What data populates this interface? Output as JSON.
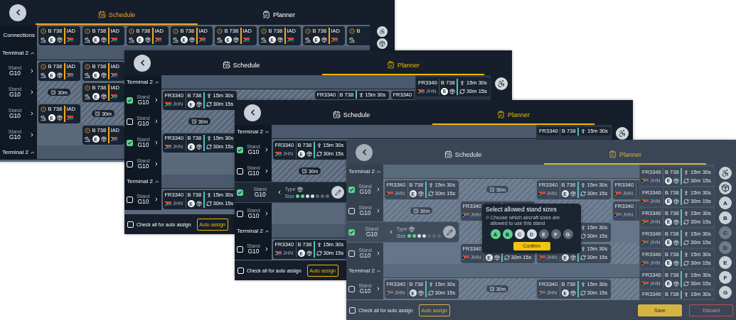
{
  "windows": [
    {
      "kind": "schedule",
      "dimmed": false,
      "tabs": [
        {
          "label": "Schedule",
          "selected": true
        },
        {
          "label": "Planner",
          "selected": false
        }
      ],
      "connections": {
        "label": "Connections",
        "flights": [
          {
            "model": "B 738",
            "category": "E",
            "dest": "IAD"
          },
          {
            "model": "B 738",
            "category": "E",
            "dest": "IAD"
          },
          {
            "model": "B 738",
            "category": "E",
            "dest": "IAD"
          },
          {
            "model": "B 738",
            "category": "E",
            "dest": "IAD"
          },
          {
            "model": "B 738",
            "category": "E",
            "dest": "IAD"
          },
          {
            "model": "B 738",
            "category": "E",
            "dest": "IAD"
          },
          {
            "model": "B 738",
            "category": "E",
            "dest": "IAD"
          },
          {
            "model": "B"
          }
        ]
      },
      "tools": [
        {
          "kind": "wheelchair"
        },
        {
          "kind": "cargo"
        }
      ],
      "groups": [
        {
          "title": "Terminal 2",
          "expanded": true,
          "stands": [
            {
              "label": "Stand",
              "name": "G10",
              "expanded": false,
              "slots": [
                {
                  "kind": "flight",
                  "model": "B 738",
                  "category": "E",
                  "dest": "IAD"
                },
                {
                  "kind": "flight",
                  "model": "B 738",
                  "category": "E",
                  "dest": "IAD"
                }
              ]
            },
            {
              "label": "Stand",
              "name": "G10",
              "expanded": false,
              "slots": [
                {
                  "kind": "break",
                  "duration": "30m"
                },
                {
                  "kind": "flight",
                  "model": "B 738",
                  "category": "E",
                  "dest": "IAD"
                }
              ]
            },
            {
              "label": "Stand",
              "name": "G10",
              "expanded": false,
              "slots": [
                {
                  "kind": "flight",
                  "model": "B 738",
                  "category": "E",
                  "dest": "IAD"
                },
                {
                  "kind": "break",
                  "duration": "30m"
                }
              ]
            },
            {
              "label": "Stand",
              "name": "G10",
              "expanded": false,
              "slots": [
                {
                  "kind": "empty"
                },
                {
                  "kind": "flight",
                  "model": "B 738",
                  "category": "E",
                  "dest": "IAD"
                }
              ]
            }
          ]
        },
        {
          "title": "Terminal 2",
          "expanded": true
        }
      ]
    },
    {
      "kind": "planner",
      "dimmed": false,
      "tabs": [
        {
          "label": "Schedule",
          "selected": false
        },
        {
          "label": "Planner",
          "selected": true
        }
      ],
      "queue": [
        {
          "flight": "FR3340",
          "origin": "JHN",
          "model": "B 738",
          "category": "E",
          "transfer": "15m 30s",
          "turnaround": "30m 15s"
        }
      ],
      "tools": [
        {
          "kind": "wheelchair"
        }
      ],
      "groups": [
        {
          "title": "Terminal 2",
          "expanded": true,
          "stands": [
            {
              "label": "Stand",
              "name": "G10",
              "checked": true,
              "expanded": false,
              "slots": [
                {
                  "kind": "flight",
                  "flight": "FR3340",
                  "origin": "JHN",
                  "model": "B 738",
                  "category": "E",
                  "transfer": "15m 30s",
                  "turnaround": "30m 15s"
                },
                {
                  "kind": "break"
                },
                {
                  "kind": "flight",
                  "flight": "FR3340",
                  "model": "B 738",
                  "transfer": "15m 30s"
                },
                {
                  "kind": "flight",
                  "flight": "FR3340"
                }
              ]
            },
            {
              "label": "Stand",
              "name": "G10",
              "checked": false,
              "expanded": false,
              "slots": [
                {
                  "kind": "break",
                  "duration": "30m"
                }
              ]
            },
            {
              "label": "Stand",
              "name": "G10",
              "checked": true,
              "expanded": false,
              "slots": [
                {
                  "kind": "flight",
                  "flight": "FR3340",
                  "origin": "JHN",
                  "model": "B 738",
                  "category": "E",
                  "transfer": "15m 30s",
                  "turnaround": "30m 15s"
                }
              ]
            },
            {
              "label": "Stand",
              "name": "G10",
              "checked": false,
              "expanded": false
            }
          ]
        },
        {
          "title": "Terminal 2",
          "expanded": true,
          "stands": [
            {
              "label": "Stand",
              "name": "G10",
              "checked": false,
              "expanded": false,
              "slots": [
                {
                  "kind": "flight",
                  "flight": "FR3340",
                  "origin": "JHN",
                  "model": "B 738",
                  "category": "E",
                  "transfer": "15m 30s",
                  "turnaround": "30m 15s"
                }
              ]
            }
          ]
        }
      ],
      "footer": {
        "check_all": {
          "label": "Check all for auto assign",
          "checked": false
        },
        "buttons": [
          {
            "label": "Auto assign",
            "kind": "outline"
          }
        ]
      }
    },
    {
      "kind": "planner",
      "dimmed": false,
      "tabs": [
        {
          "label": "Schedule",
          "selected": false
        },
        {
          "label": "Planner",
          "selected": true
        }
      ],
      "queue": [
        {
          "flight": "FR3340",
          "model": "B 738",
          "transfer": "15m 30s"
        }
      ],
      "tools": [
        {
          "kind": "wheelchair"
        }
      ],
      "groups": [
        {
          "title": "Terminal 2",
          "expanded": true,
          "stands": [
            {
              "label": "Stand",
              "name": "G10",
              "checked": true,
              "expanded": false,
              "slots": [
                {
                  "kind": "flight",
                  "flight": "FR3340",
                  "origin": "JHN",
                  "model": "B 738",
                  "category": "E",
                  "transfer": "15m 30s",
                  "turnaround": "30m 15s"
                }
              ]
            },
            {
              "label": "Stand",
              "name": "G10",
              "checked": false,
              "expanded": false,
              "slots": [
                {
                  "kind": "break",
                  "duration": "30m"
                }
              ]
            },
            {
              "label": "Stand",
              "name": "G10",
              "checked": true,
              "expanded": true,
              "type_label": "Type",
              "size_label": "Size",
              "sizes": [
                {
                  "selected": true,
                  "disabled": false
                },
                {
                  "selected": true,
                  "disabled": false
                },
                {
                  "selected": false,
                  "disabled": false
                },
                {
                  "selected": false,
                  "disabled": false
                },
                {
                  "selected": false,
                  "disabled": true
                },
                {
                  "selected": false,
                  "disabled": true
                },
                {
                  "selected": false,
                  "disabled": true
                }
              ]
            },
            {
              "label": "Stand",
              "name": "G10",
              "checked": false,
              "expanded": false
            }
          ]
        },
        {
          "title": "Terminal 2",
          "expanded": true,
          "stands": [
            {
              "label": "Stand",
              "name": "G10",
              "checked": false,
              "expanded": false,
              "slots": [
                {
                  "kind": "flight",
                  "flight": "FR3340",
                  "origin": "JHN",
                  "model": "B 738",
                  "category": "E",
                  "transfer": "15m 30s",
                  "turnaround": "30m 15s"
                }
              ]
            }
          ]
        }
      ],
      "footer": {
        "check_all": {
          "label": "Check all for auto assign",
          "checked": false
        },
        "buttons": [
          {
            "label": "Auto assign",
            "kind": "outline"
          }
        ]
      }
    },
    {
      "kind": "planner",
      "dimmed": true,
      "tabs": [
        {
          "label": "Schedule",
          "selected": false
        },
        {
          "label": "Planner",
          "selected": true
        }
      ],
      "queue": [
        {
          "flight": "FR3340",
          "origin": "JHN",
          "model": "B 738",
          "category": "E",
          "transfer": "15m 30s",
          "turnaround": "30m 15s"
        },
        {
          "flight": "FR3340",
          "origin": "JHN",
          "model": "B 738",
          "category": "E",
          "transfer": "15m 30s",
          "turnaround": "30m 15s"
        },
        {
          "flight": "FR3340",
          "origin": "JHN",
          "model": "B 738",
          "category": "E",
          "transfer": "15m 30s",
          "turnaround": "30m 15s"
        },
        {
          "flight": "FR3340",
          "origin": "JHN",
          "model": "B 738",
          "category": "E",
          "transfer": "15m 30s",
          "turnaround": "30m 15s"
        },
        {
          "flight": "FR3340",
          "origin": "JHN",
          "model": "B 738",
          "category": "E",
          "transfer": "15m 30s",
          "turnaround": "30m 15s"
        },
        {
          "flight": "FR3340",
          "origin": "JHN",
          "model": "B 738",
          "category": "E",
          "transfer": "15m 30s",
          "turnaround": "30m 15s"
        },
        {
          "flight": "FR3340",
          "model": "B 738",
          "transfer": "15m 30s"
        }
      ],
      "tools": [
        {
          "kind": "wheelchair"
        },
        {
          "kind": "cargo"
        },
        {
          "kind": "size",
          "label": "A",
          "disabled": false
        },
        {
          "kind": "size",
          "label": "B",
          "disabled": false
        },
        {
          "kind": "size",
          "label": "C",
          "disabled": true
        },
        {
          "kind": "size",
          "label": "D",
          "disabled": true
        },
        {
          "kind": "size",
          "label": "E",
          "disabled": false
        },
        {
          "kind": "size",
          "label": "F",
          "disabled": false
        },
        {
          "kind": "size",
          "label": "G",
          "disabled": false
        }
      ],
      "groups": [
        {
          "title": "Terminal 2",
          "expanded": true,
          "stands": [
            {
              "label": "Stand",
              "name": "G10",
              "checked": true,
              "expanded": false,
              "slots": [
                {
                  "kind": "flight",
                  "flight": "FR3340",
                  "origin": "JHN",
                  "model": "B 738",
                  "category": "E",
                  "transfer": "15m 30s",
                  "turnaround": "30m 15s"
                },
                {
                  "kind": "break",
                  "duration": "30m"
                },
                {
                  "kind": "flight",
                  "flight": "FR3340",
                  "origin": "JHN",
                  "model": "B 738",
                  "category": "E",
                  "transfer": "15m 30s",
                  "turnaround": "30m 15s"
                },
                {
                  "kind": "flight",
                  "flight": "FR3340",
                  "origin": "JHN"
                }
              ]
            },
            {
              "label": "Stand",
              "name": "G10",
              "checked": false,
              "expanded": false,
              "slots": [
                {
                  "kind": "break",
                  "duration": "30m"
                },
                {
                  "kind": "flight",
                  "flight": "FR3340",
                  "origin": "JHN"
                },
                {
                  "kind": "break"
                },
                {
                  "kind": "flight",
                  "flight": "FR3340",
                  "origin": "JHN"
                }
              ]
            },
            {
              "label": "Stand",
              "name": "G10",
              "checked": true,
              "expanded": true,
              "type_label": "Type",
              "size_label": "Size",
              "sizes": [
                {
                  "selected": true,
                  "disabled": false
                },
                {
                  "selected": true,
                  "disabled": false
                },
                {
                  "selected": false,
                  "disabled": false
                },
                {
                  "selected": false,
                  "disabled": false
                },
                {
                  "selected": false,
                  "disabled": true
                },
                {
                  "selected": false,
                  "disabled": true
                },
                {
                  "selected": false,
                  "disabled": true
                }
              ],
              "slots": [
                {
                  "kind": "break"
                },
                {
                  "kind": "flight",
                  "transfer": "15m 30s",
                  "turnaround": "30m 15s"
                }
              ]
            },
            {
              "label": "Stand",
              "name": "G10",
              "checked": false,
              "expanded": false,
              "slots": [
                {
                  "kind": "empty"
                },
                {
                  "kind": "flight",
                  "flight": "FR3340",
                  "origin": "JHN",
                  "category": "E",
                  "turnaround": "30m 15s"
                },
                {
                  "kind": "flight",
                  "origin": "JHN",
                  "category": "E",
                  "transfer": "15m 30s",
                  "turnaround": "30m 15s"
                },
                {
                  "kind": "break"
                }
              ]
            }
          ]
        },
        {
          "title": "Terminal 2",
          "expanded": true,
          "stands": [
            {
              "label": "Stand",
              "name": "G10",
              "checked": false,
              "expanded": false,
              "slots": [
                {
                  "kind": "flight",
                  "flight": "FR3340",
                  "origin": "JHN",
                  "model": "B 738",
                  "category": "E",
                  "transfer": "15m 30s",
                  "turnaround": "30m 15s"
                },
                {
                  "kind": "break",
                  "duration": "30m"
                },
                {
                  "kind": "flight",
                  "flight": "FR3340",
                  "origin": "JHN",
                  "model": "B 738",
                  "category": "E",
                  "transfer": "15m 30s",
                  "turnaround": "30m 15s"
                },
                {
                  "kind": "break"
                }
              ]
            }
          ]
        }
      ],
      "footer": {
        "check_all": {
          "label": "Check all for auto assign",
          "checked": false
        },
        "buttons": [
          {
            "label": "Auto assign",
            "kind": "outline"
          },
          {
            "label": "Save",
            "kind": "primary"
          },
          {
            "label": "Discard",
            "kind": "danger"
          }
        ]
      },
      "popup": {
        "title": "Select allowed stand sizes",
        "hint": "Choose which aircraft sizes are allowed to use this stand",
        "sizes": [
          {
            "label": "A",
            "selected": true,
            "disabled": false
          },
          {
            "label": "B",
            "selected": true,
            "disabled": false
          },
          {
            "label": "C",
            "selected": false,
            "disabled": false
          },
          {
            "label": "D",
            "selected": false,
            "disabled": false
          },
          {
            "label": "E",
            "selected": false,
            "disabled": true
          },
          {
            "label": "F",
            "selected": false,
            "disabled": true
          },
          {
            "label": "G",
            "selected": false,
            "disabled": true
          }
        ],
        "confirm": "Confirm"
      }
    }
  ]
}
